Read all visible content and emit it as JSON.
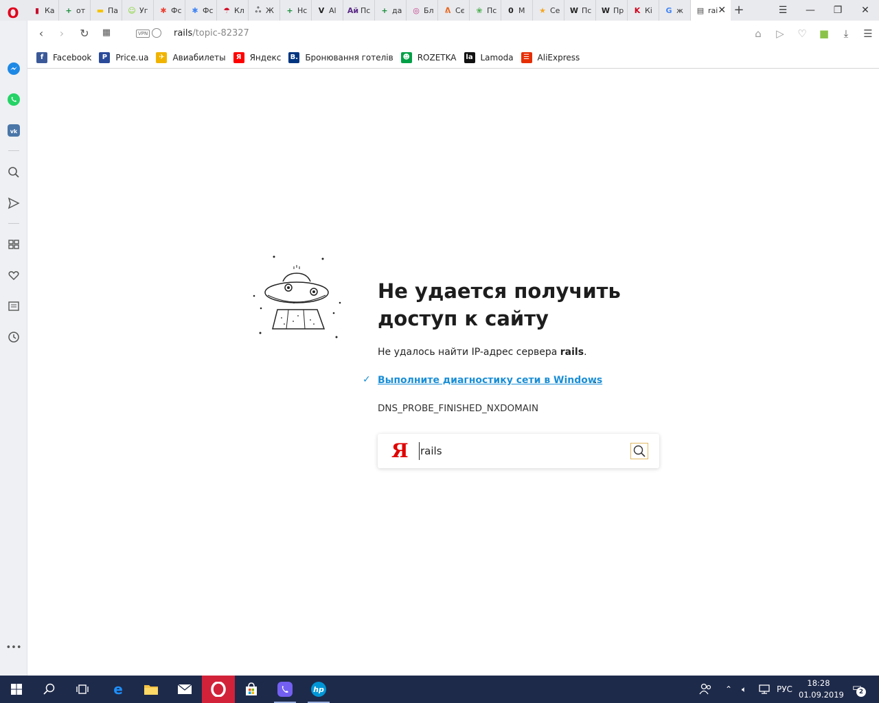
{
  "tabs": [
    {
      "label": "Ка",
      "icon": "bars-icon",
      "color": "#c8102e",
      "glyph": "▮",
      "width": 46
    },
    {
      "label": "от",
      "icon": "green-plus-icon",
      "color": "#1a8f3c",
      "glyph": "+",
      "width": 46
    },
    {
      "label": "Па",
      "icon": "yellow-black-icon",
      "color": "#f5c400",
      "glyph": "▬",
      "width": 46
    },
    {
      "label": "Уг",
      "icon": "smiley-icon",
      "color": "#7ed321",
      "glyph": "☺",
      "width": 46
    },
    {
      "label": "Фс",
      "icon": "pinwheel-icon",
      "color": "#ea4335",
      "glyph": "✱",
      "width": 46
    },
    {
      "label": "Фс",
      "icon": "pinwheel-icon",
      "color": "#4285f4",
      "glyph": "✱",
      "width": 46
    },
    {
      "label": "Кл",
      "icon": "umbrella-icon",
      "color": "#d0021b",
      "glyph": "☂",
      "width": 46
    },
    {
      "label": "Ж",
      "icon": "crowd-icon",
      "color": "#555555",
      "glyph": "ஃ",
      "width": 46
    },
    {
      "label": "Нс",
      "icon": "green-plus-icon",
      "color": "#1a8f3c",
      "glyph": "+",
      "width": 46
    },
    {
      "label": "Al",
      "icon": "v-icon",
      "color": "#222222",
      "glyph": "V",
      "width": 46
    },
    {
      "label": "Пс",
      "icon": "ai-icon",
      "color": "#5b2a86",
      "glyph": "Ай",
      "width": 46
    },
    {
      "label": "да",
      "icon": "green-plus-icon",
      "color": "#1a8f3c",
      "glyph": "+",
      "width": 46
    },
    {
      "label": "Бл",
      "icon": "instagram-icon",
      "color": "#c13584",
      "glyph": "◎",
      "width": 46
    },
    {
      "label": "Сє",
      "icon": "fox-icon",
      "color": "#e8641c",
      "glyph": "ᕕ",
      "width": 46
    },
    {
      "label": "Пс",
      "icon": "leaf-icon",
      "color": "#4caf50",
      "glyph": "❀",
      "width": 46
    },
    {
      "label": "М",
      "icon": "o-icon",
      "color": "#222222",
      "glyph": "0",
      "width": 46
    },
    {
      "label": "Се",
      "icon": "star-icon",
      "color": "#f5a623",
      "glyph": "★",
      "width": 46
    },
    {
      "label": "Пс",
      "icon": "wikipedia-icon",
      "color": "#222222",
      "glyph": "W",
      "width": 46
    },
    {
      "label": "Пр",
      "icon": "wikipedia-icon",
      "color": "#222222",
      "glyph": "W",
      "width": 46
    },
    {
      "label": "Кі",
      "icon": "k-icon",
      "color": "#d0021b",
      "glyph": "K",
      "width": 46
    },
    {
      "label": "ж",
      "icon": "google-icon",
      "color": "#4285f4",
      "glyph": "G",
      "width": 46
    },
    {
      "label": "rai",
      "icon": "page-icon",
      "color": "#444444",
      "glyph": "▤",
      "width": 58,
      "active": true
    }
  ],
  "address": {
    "host": "rails",
    "path": "/topic-82327",
    "vpn": "VPN"
  },
  "bookmarks": [
    {
      "label": "Facebook",
      "icon": "facebook-icon",
      "color": "#3b5998",
      "glyph": "f"
    },
    {
      "label": "Price.ua",
      "icon": "price-icon",
      "color": "#2a4a9a",
      "glyph": "P"
    },
    {
      "label": "Авиабилеты",
      "icon": "plane-icon",
      "color": "#f0b400",
      "glyph": "✈"
    },
    {
      "label": "Яндекс",
      "icon": "yandex-icon",
      "color": "#ff0000",
      "glyph": "Я"
    },
    {
      "label": "Бронювання готелів",
      "icon": "booking-icon",
      "color": "#003580",
      "glyph": "B."
    },
    {
      "label": "ROZETKA",
      "icon": "rozetka-icon",
      "color": "#00a046",
      "glyph": "☻"
    },
    {
      "label": "Lamoda",
      "icon": "lamoda-icon",
      "color": "#111111",
      "glyph": "la"
    },
    {
      "label": "AliExpress",
      "icon": "aliexpress-icon",
      "color": "#e62e04",
      "glyph": "☰"
    }
  ],
  "error": {
    "title": "Не удается получить доступ к сайту",
    "desc_prefix": "Не удалось найти IP-адрес сервера ",
    "desc_host": "rails",
    "desc_suffix": ".",
    "diag_link": "Выполните диагностику сети в Windows",
    "diag_suffix": ".",
    "code": "DNS_PROBE_FINISHED_NXDOMAIN"
  },
  "search": {
    "logo": "Я",
    "value": "rails"
  },
  "taskbar": {
    "language": "РУС",
    "time": "18:28",
    "date": "01.09.2019",
    "notifications": "2"
  },
  "colors": {
    "accent_link": "#1a8ed6",
    "opera_red": "#e0001b",
    "taskbar_bg": "#1e2a4a"
  }
}
